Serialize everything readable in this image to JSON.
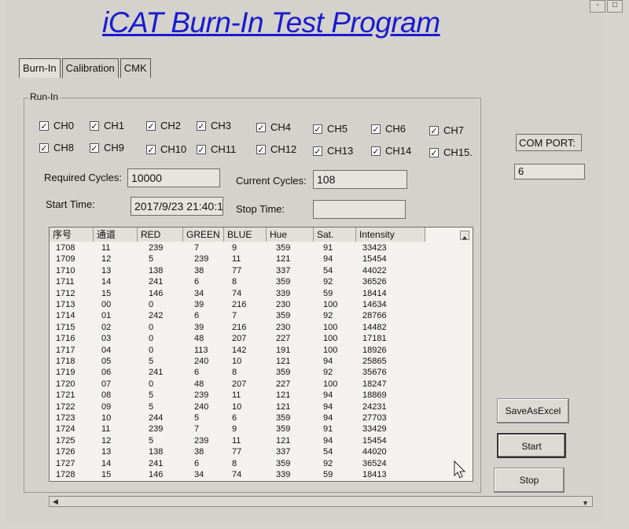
{
  "window": {
    "title": "iCAT Burn-In Test Program",
    "controls": [
      "-",
      "□"
    ]
  },
  "tabs": [
    {
      "label": "Burn-In",
      "active": true
    },
    {
      "label": "Calibration",
      "active": false
    },
    {
      "label": "CMK",
      "active": false
    }
  ],
  "runin": {
    "group_label": "Run-In",
    "channels": [
      {
        "label": "CH0",
        "checked": true
      },
      {
        "label": "CH1",
        "checked": true
      },
      {
        "label": "CH2",
        "checked": true
      },
      {
        "label": "CH3",
        "checked": true
      },
      {
        "label": "CH4",
        "checked": true
      },
      {
        "label": "CH5",
        "checked": true
      },
      {
        "label": "CH6",
        "checked": true
      },
      {
        "label": "CH7",
        "checked": true
      },
      {
        "label": "CH8",
        "checked": true
      },
      {
        "label": "CH9",
        "checked": true
      },
      {
        "label": "CH10",
        "checked": true
      },
      {
        "label": "CH11",
        "checked": true
      },
      {
        "label": "CH12",
        "checked": true
      },
      {
        "label": "CH13",
        "checked": true
      },
      {
        "label": "CH14",
        "checked": true
      },
      {
        "label": "CH15.",
        "checked": true
      }
    ],
    "required_cycles_label": "Required Cycles:",
    "required_cycles": "10000",
    "current_cycles_label": "Current Cycles:",
    "current_cycles": "108",
    "start_time_label": "Start Time:",
    "start_time": "2017/9/23 21:40:1",
    "stop_time_label": "Stop Time:",
    "stop_time": ""
  },
  "table": {
    "columns": [
      "序号",
      "通道",
      "RED",
      "GREEN",
      "BLUE",
      "Hue",
      "Sat.",
      "Intensity"
    ],
    "rows": [
      [
        "1708",
        "11",
        "239",
        "7",
        "9",
        "359",
        "91",
        "33423"
      ],
      [
        "1709",
        "12",
        "5",
        "239",
        "11",
        "121",
        "94",
        "15454"
      ],
      [
        "1710",
        "13",
        "138",
        "38",
        "77",
        "337",
        "54",
        "44022"
      ],
      [
        "1711",
        "14",
        "241",
        "6",
        "8",
        "359",
        "92",
        "36526"
      ],
      [
        "1712",
        "15",
        "146",
        "34",
        "74",
        "339",
        "59",
        "18414"
      ],
      [
        "1713",
        "00",
        "0",
        "39",
        "216",
        "230",
        "100",
        "14634"
      ],
      [
        "1714",
        "01",
        "242",
        "6",
        "7",
        "359",
        "92",
        "28766"
      ],
      [
        "1715",
        "02",
        "0",
        "39",
        "216",
        "230",
        "100",
        "14482"
      ],
      [
        "1716",
        "03",
        "0",
        "48",
        "207",
        "227",
        "100",
        "17181"
      ],
      [
        "1717",
        "04",
        "0",
        "113",
        "142",
        "191",
        "100",
        "18926"
      ],
      [
        "1718",
        "05",
        "5",
        "240",
        "10",
        "121",
        "94",
        "25865"
      ],
      [
        "1719",
        "06",
        "241",
        "6",
        "8",
        "359",
        "92",
        "35676"
      ],
      [
        "1720",
        "07",
        "0",
        "48",
        "207",
        "227",
        "100",
        "18247"
      ],
      [
        "1721",
        "08",
        "5",
        "239",
        "11",
        "121",
        "94",
        "18869"
      ],
      [
        "1722",
        "09",
        "5",
        "240",
        "10",
        "121",
        "94",
        "24231"
      ],
      [
        "1723",
        "10",
        "244",
        "5",
        "6",
        "359",
        "94",
        "27703"
      ],
      [
        "1724",
        "11",
        "239",
        "7",
        "9",
        "359",
        "91",
        "33429"
      ],
      [
        "1725",
        "12",
        "5",
        "239",
        "11",
        "121",
        "94",
        "15454"
      ],
      [
        "1726",
        "13",
        "138",
        "38",
        "77",
        "337",
        "54",
        "44020"
      ],
      [
        "1727",
        "14",
        "241",
        "6",
        "8",
        "359",
        "92",
        "36524"
      ],
      [
        "1728",
        "15",
        "146",
        "34",
        "74",
        "339",
        "59",
        "18413"
      ]
    ]
  },
  "com_port": {
    "label": "COM PORT:",
    "value": "6"
  },
  "buttons": {
    "save_excel": "SaveAsExcel",
    "start": "Start",
    "stop": "Stop"
  }
}
